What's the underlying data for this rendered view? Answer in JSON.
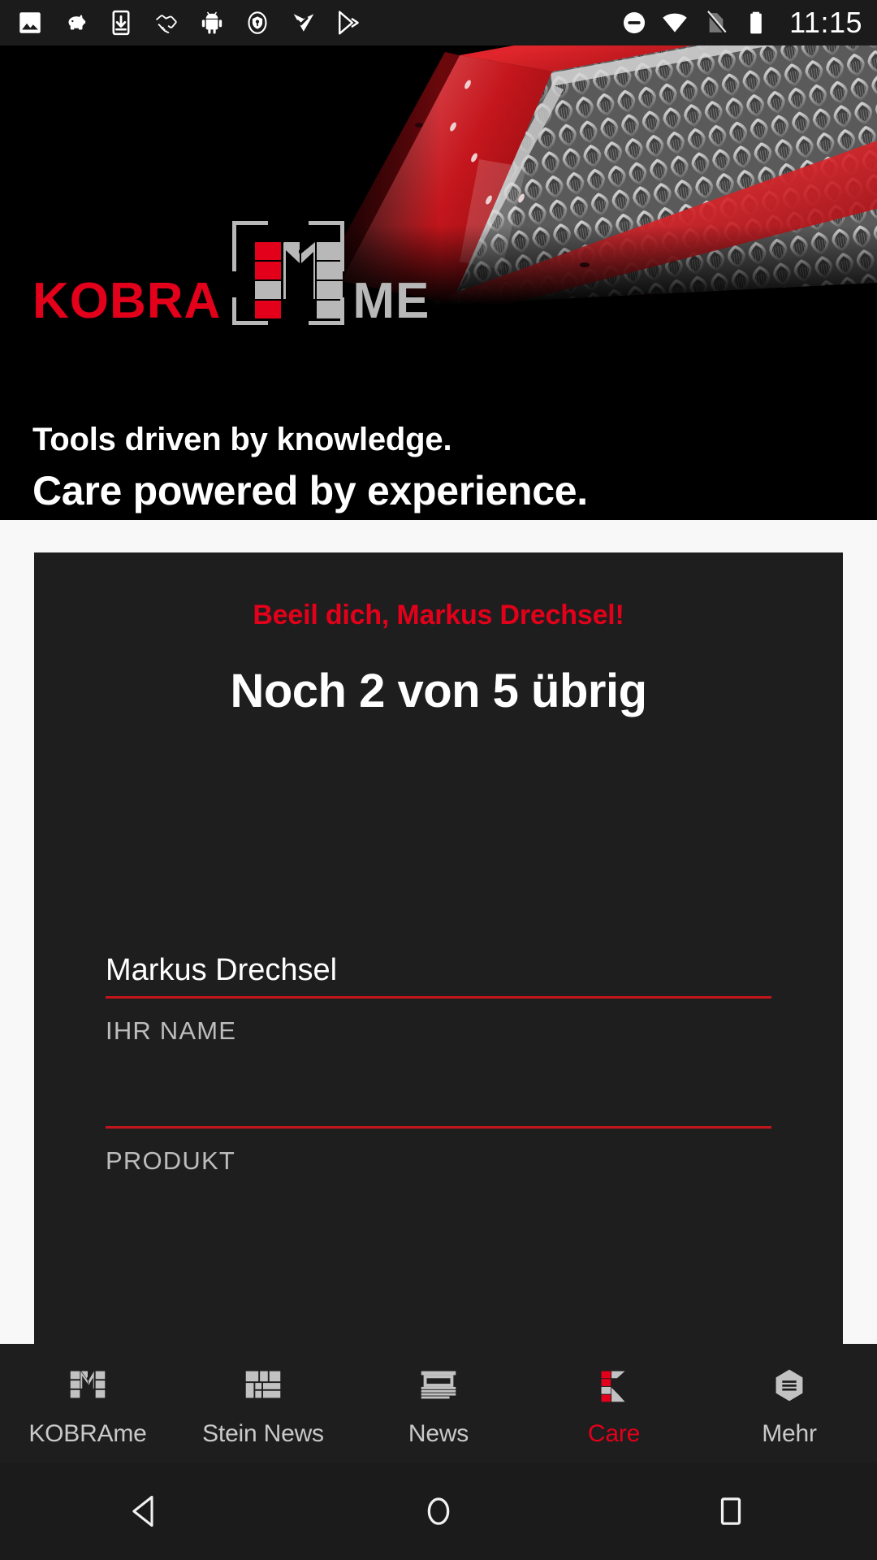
{
  "status_bar": {
    "time": "11:15",
    "left_icons": [
      "image-icon",
      "piggy-bank-icon",
      "download-to-device-icon",
      "handshake-icon",
      "android-icon",
      "security-shield-icon",
      "task-check-icon",
      "play-store-icon"
    ],
    "right_icons": [
      "do-not-disturb-icon",
      "wifi-icon",
      "no-sim-icon",
      "battery-icon"
    ]
  },
  "hero": {
    "logo": {
      "brand": "KOBRA",
      "suffix": "ME",
      "mark": "kobra-m-mark"
    },
    "tagline_line1": "Tools driven by knowledge.",
    "tagline_line2": "Care powered by experience.",
    "image_alt": "honeycomb-panel-render"
  },
  "card": {
    "alert_text": "Beeil dich, Markus Drechsel!",
    "heading": "Noch 2 von 5 übrig",
    "fields": [
      {
        "value": "Markus Drechsel",
        "label": "IHR NAME",
        "placeholder": ""
      },
      {
        "value": "",
        "label": "PRODUKT",
        "placeholder": ""
      }
    ]
  },
  "tabbar": {
    "items": [
      {
        "label": "KOBRAme",
        "icon": "kobra-m-icon",
        "active": false
      },
      {
        "label": "Stein News",
        "icon": "grid-blocks-icon",
        "active": false
      },
      {
        "label": "News",
        "icon": "newspaper-icon",
        "active": false
      },
      {
        "label": "Care",
        "icon": "kobra-k-icon",
        "active": true
      },
      {
        "label": "Mehr",
        "icon": "hexagon-menu-icon",
        "active": false
      }
    ]
  },
  "android_nav": {
    "back": "back-triangle-icon",
    "home": "home-circle-icon",
    "recents": "recents-square-icon"
  },
  "colors": {
    "accent_red": "#e2001a",
    "underline_red": "#c2161c",
    "logo_gray": "#b8b8b8",
    "card_bg": "#1e1e1e",
    "page_bg": "#f8f8f8",
    "hero_bg": "#000000"
  }
}
